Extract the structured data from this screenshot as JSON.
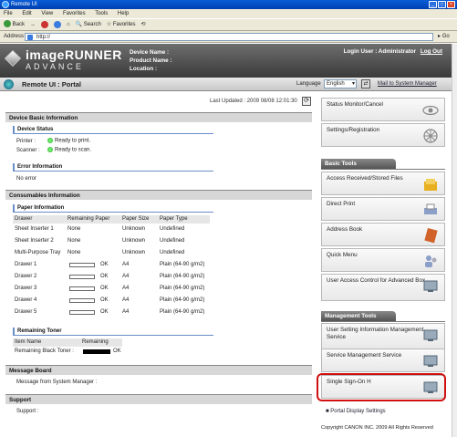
{
  "browser": {
    "title": "Remote UI",
    "menu": [
      "File",
      "Edit",
      "View",
      "Favorites",
      "Tools",
      "Help"
    ],
    "toolbar": {
      "back": "Back",
      "search": "Search",
      "favorites": "Favorites"
    },
    "address_label": "Address",
    "address_value": "http://",
    "go": "Go"
  },
  "header": {
    "brand_line1": "imageRUNNER",
    "brand_line2": "ADVANCE",
    "device_name": "Device Name :",
    "product_name": "Product Name :",
    "location": "Location :",
    "login_user": "Login User : Administrator",
    "logout": "Log Out"
  },
  "portalbar": {
    "title": "Remote UI : Portal",
    "language_label": "Language",
    "language_value": "English",
    "mail_link": "Mail to System Manager"
  },
  "main": {
    "last_updated": "Last Updated : 2009 08/08 12:01:30",
    "device_basic_info": "Device Basic Information",
    "device_status": "Device Status",
    "printer_label": "Printer :",
    "printer_status": "Ready to print.",
    "scanner_label": "Scanner :",
    "scanner_status": "Ready to scan.",
    "error_info": "Error Information",
    "error_value": "No error",
    "consumables_info": "Consumables Information",
    "paper_info": "Paper Information",
    "paper_columns": [
      "Drawer",
      "Remaining Paper",
      "Paper Size",
      "Paper Type"
    ],
    "paper_rows": [
      {
        "drawer": "Sheet Inserter 1",
        "remaining": "None",
        "size": "Unknown",
        "type": "Undefined"
      },
      {
        "drawer": "Sheet Inserter 2",
        "remaining": "None",
        "size": "Unknown",
        "type": "Undefined"
      },
      {
        "drawer": "Multi-Purpose Tray",
        "remaining": "None",
        "size": "Unknown",
        "type": "Undefined"
      },
      {
        "drawer": "Drawer 1",
        "remaining": "OK",
        "size": "A4",
        "type": "Plain (64-90 g/m2)"
      },
      {
        "drawer": "Drawer 2",
        "remaining": "OK",
        "size": "A4",
        "type": "Plain (64-90 g/m2)"
      },
      {
        "drawer": "Drawer 3",
        "remaining": "OK",
        "size": "A4",
        "type": "Plain (64-90 g/m2)"
      },
      {
        "drawer": "Drawer 4",
        "remaining": "OK",
        "size": "A4",
        "type": "Plain (64-90 g/m2)"
      },
      {
        "drawer": "Drawer 5",
        "remaining": "OK",
        "size": "A4",
        "type": "Plain (64-90 g/m2)"
      }
    ],
    "remaining_toner": "Remaining Toner",
    "toner_columns": [
      "Item Name",
      "Remaining"
    ],
    "toner_item": "Remaining Black Toner :",
    "toner_value": "OK",
    "message_board": "Message Board",
    "message_label": "Message from System Manager :",
    "support": "Support",
    "support_label": "Support :"
  },
  "right": {
    "status_monitor": "Status Monitor/Cancel",
    "settings": "Settings/Registration",
    "basic_tools": "Basic Tools",
    "access_files": "Access Received/Stored Files",
    "direct_print": "Direct Print",
    "address_book": "Address Book",
    "quick_menu": "Quick Menu",
    "user_access_control": "User Access Control for Advanced Box",
    "management_tools": "Management Tools",
    "user_setting_mgmt": "User Setting Information Management Service",
    "service_mgmt": "Service Management Service",
    "single_sign_on": "Single Sign-On H",
    "portal_display": "Portal Display Settings",
    "copyright": "Copyright CANON INC. 2009 All Rights Reserved"
  }
}
